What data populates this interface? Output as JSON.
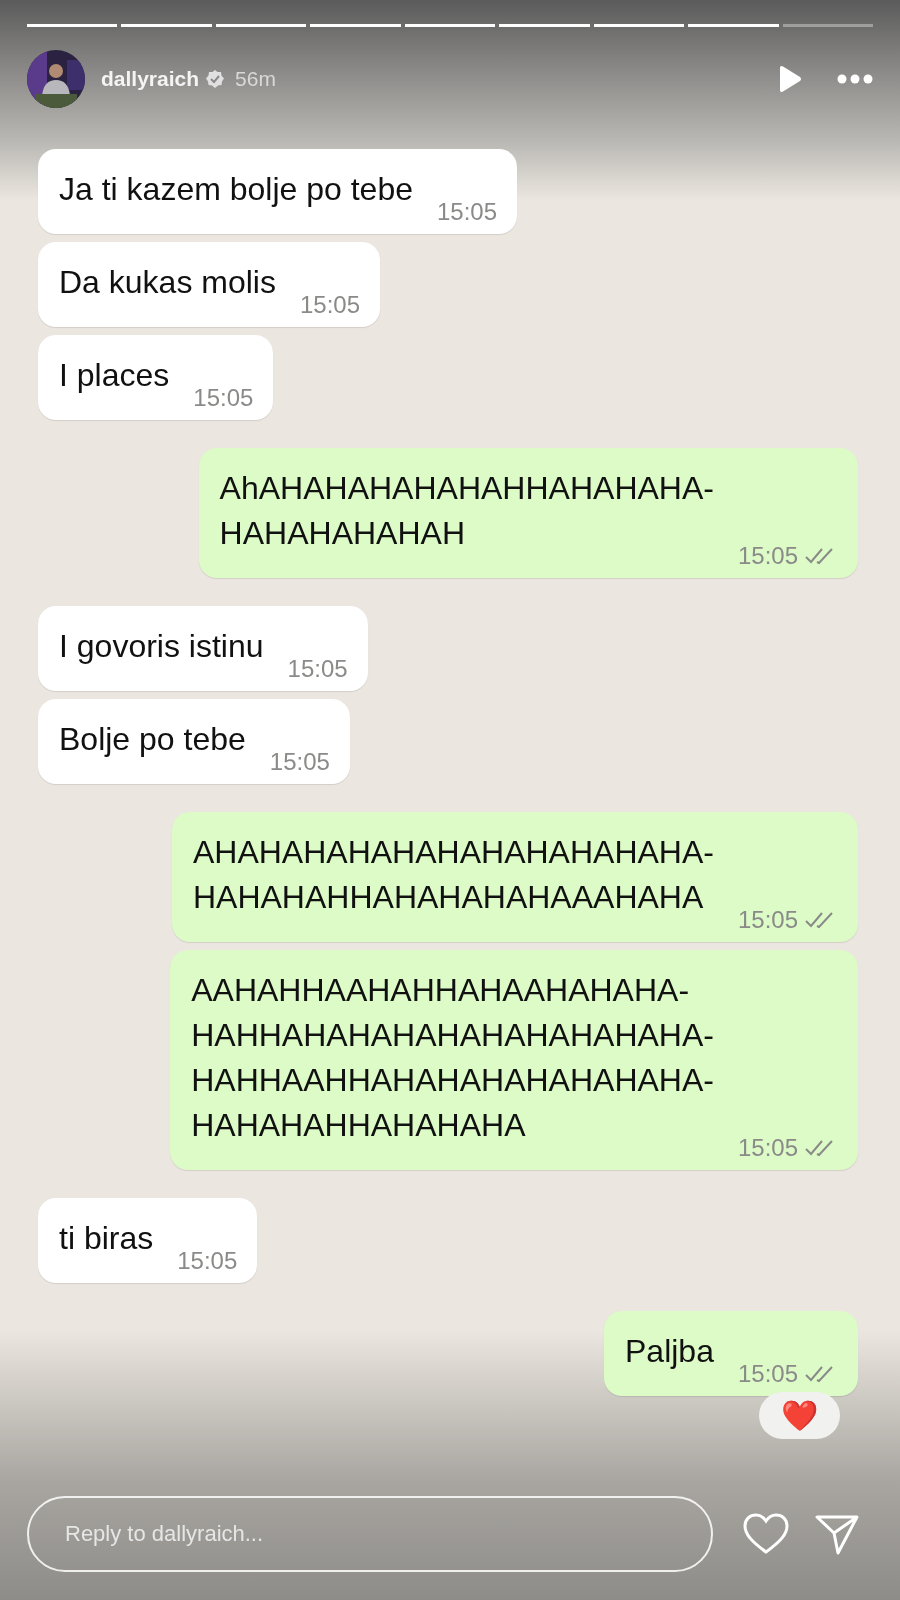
{
  "progress": [
    {
      "level": 1
    },
    {
      "level": 1
    },
    {
      "level": 1
    },
    {
      "level": 1
    },
    {
      "level": 1
    },
    {
      "level": 1
    },
    {
      "level": 1
    },
    {
      "level": 1
    },
    {
      "level": 0
    }
  ],
  "header": {
    "username": "dallyraich",
    "verified": true,
    "age": "56m"
  },
  "messages": [
    {
      "kind": "received",
      "lines": [
        "Ja ti kazem bolje po tebe"
      ],
      "time": "15:05"
    },
    {
      "kind": "received",
      "lines": [
        "Da kukas molis"
      ],
      "time": "15:05"
    },
    {
      "kind": "received",
      "lines": [
        "I places"
      ],
      "time": "15:05"
    },
    {
      "kind": "sent",
      "lines": [
        "AhAHAHAHAHAHAHHAHAHAHA-",
        "HAHAHAHAHAH"
      ],
      "time": "15:05"
    },
    {
      "kind": "received",
      "lines": [
        "I govoris istinu"
      ],
      "time": "15:05"
    },
    {
      "kind": "received",
      "lines": [
        "Bolje po tebe"
      ],
      "time": "15:05"
    },
    {
      "kind": "sent",
      "lines": [
        "AHAHAHAHAHAHAHAHAHAHAHA-",
        "HAHAHAHHAHAHAHAHAAAHAHA"
      ],
      "time": "15:05"
    },
    {
      "kind": "sent",
      "lines": [
        "AAHAHHAAHAHHAHAAHAHAHA-",
        "HAHHAHAHAHAHAHAHAHAHAHA-",
        "HAHHAAHHAHAHAHAHAHAHAHA-",
        "HAHAHAHHAHAHAHA"
      ],
      "time": "15:05"
    },
    {
      "kind": "received",
      "lines": [
        "ti biras"
      ],
      "time": "15:05"
    },
    {
      "kind": "sent",
      "lines": [
        "Paljba"
      ],
      "time": "15:05",
      "reaction": "❤️"
    }
  ],
  "reply": {
    "placeholder": "Reply to dallyraich..."
  }
}
